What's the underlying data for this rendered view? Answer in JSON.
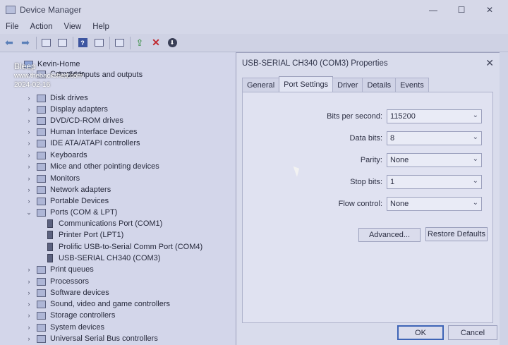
{
  "window": {
    "title": "Device Manager"
  },
  "menu": [
    "File",
    "Action",
    "View",
    "Help"
  ],
  "watermark": {
    "line1": "Bleep",
    "line2": "www.thebackshed.com",
    "line3": "2024-02-16"
  },
  "tree": {
    "root": "Kevin-Home",
    "computer": "Computer",
    "items": [
      "Audio inputs and outputs",
      "Disk drives",
      "Display adapters",
      "DVD/CD-ROM drives",
      "Human Interface Devices",
      "IDE ATA/ATAPI controllers",
      "Keyboards",
      "Mice and other pointing devices",
      "Monitors",
      "Network adapters",
      "Portable Devices"
    ],
    "ports": {
      "label": "Ports (COM & LPT)",
      "children": [
        "Communications Port (COM1)",
        "Printer Port (LPT1)",
        "Prolific USB-to-Serial Comm Port (COM4)",
        "USB-SERIAL CH340 (COM3)"
      ]
    },
    "items_after": [
      "Print queues",
      "Processors",
      "Software devices",
      "Sound, video and game controllers",
      "Storage controllers",
      "System devices",
      "Universal Serial Bus controllers"
    ]
  },
  "dialog": {
    "title": "USB-SERIAL CH340 (COM3) Properties",
    "close": "✕",
    "tabs": [
      "General",
      "Port Settings",
      "Driver",
      "Details",
      "Events"
    ],
    "active_tab": "Port Settings",
    "fields": [
      {
        "label": "Bits per second:",
        "value": "115200"
      },
      {
        "label": "Data bits:",
        "value": "8"
      },
      {
        "label": "Parity:",
        "value": "None"
      },
      {
        "label": "Stop bits:",
        "value": "1"
      },
      {
        "label": "Flow control:",
        "value": "None"
      }
    ],
    "advanced_button": "Advanced...",
    "restore_button": "Restore Defaults",
    "ok_button": "OK",
    "cancel_button": "Cancel"
  }
}
